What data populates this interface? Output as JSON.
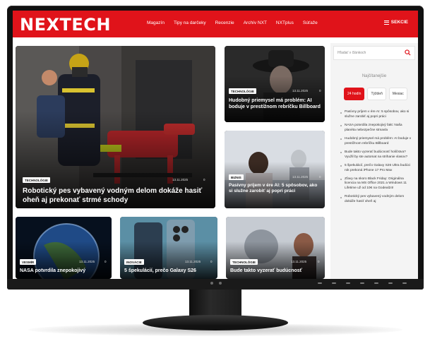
{
  "site": {
    "logo": "NEXTECH",
    "nav": [
      "Magazín",
      "Tipy na darčeky",
      "Recenzie",
      "Archív NXT",
      "NXTplus",
      "Súťaže"
    ],
    "sections_label": "SEKCIE"
  },
  "featured": {
    "tag": "TECHNOLÓGIE",
    "date": "13.11.2025",
    "comments": "0",
    "title": "Robotický pes vybavený vodným delom dokáže hasiť oheň aj prekonať strmé schody"
  },
  "side_cards": [
    {
      "tag": "TECHNOLÓGIE",
      "date": "13.11.2025",
      "comments": "0",
      "title": "Hudobný priemysel má problém: AI boduje v prestížnom rebríčku Billboard"
    },
    {
      "tag": "BIZNIS",
      "date": "13.11.2025",
      "comments": "0",
      "title": "Pasívny príjem v ére AI: 5 spôsobov, ako si služne zarobiť aj popri práci"
    }
  ],
  "bottom_cards": [
    {
      "tag": "VESMÍR",
      "date": "13.11.2025",
      "comments": "0",
      "title": "NASA potvrdila znepokojivý"
    },
    {
      "tag": "INOVÁCIE",
      "date": "13.11.2025",
      "comments": "0",
      "title": "5 špekulácií, prečo Galaxy S26"
    },
    {
      "tag": "TECHNOLÓGIE",
      "date": "13.11.2025",
      "comments": "0",
      "title": "Bude takto vyzerať budúcnosť"
    }
  ],
  "sidebar": {
    "search_placeholder": "Hľadať v článkoch",
    "popular_title": "Najčítanejšie",
    "tabs": [
      "24 hodín",
      "Týždeň",
      "Mesiac"
    ],
    "active_tab": "24 hodín",
    "items": [
      "Pasívny príjem v ére AI: 5 spôsobov, ako si služne zarobiť aj popri práci",
      "NASA potvrdila znepokojivý fakt: Naša planéta nebezpečne stmavla",
      "Hudobný priemysel má problém: AI boduje v prestížnom rebríčku Billboard",
      "Bude takto vyzerať budúcnosť holičstva? Využil by ste automat na strihanie vlasov?",
      "5 špekulácií, prečo Galaxy S26 Ultra budúci rok prekoná iPhone 17 Pro Max",
      "Zľavy na skoro Black Friday: Originálna licencia na MS Office 2021 a Windows 11 Lifetime už od 10€ na Godeal24!",
      "Robotický pes vybavený vodným delom dokáže hasiť oheň aj"
    ]
  },
  "colors": {
    "brand": "#e0131a"
  }
}
